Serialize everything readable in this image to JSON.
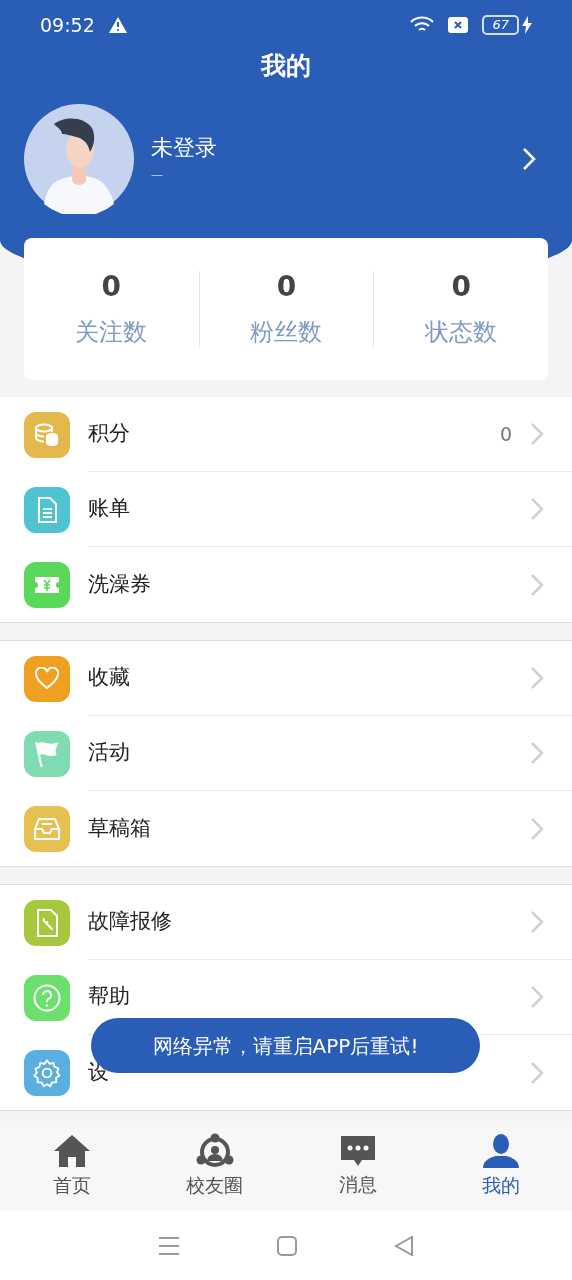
{
  "status_bar": {
    "time": "09:52",
    "battery": "67"
  },
  "header": {
    "title": "我的"
  },
  "profile": {
    "name": "未登录",
    "subtitle": "—"
  },
  "stats": [
    {
      "value": "0",
      "label": "关注数"
    },
    {
      "value": "0",
      "label": "粉丝数"
    },
    {
      "value": "0",
      "label": "状态数"
    }
  ],
  "menu_sections": [
    [
      {
        "kind": "coins",
        "label": "积分",
        "value": "0",
        "color": "#e3b94e"
      },
      {
        "kind": "document",
        "label": "账单",
        "color": "#4fc3d0"
      },
      {
        "kind": "ticket",
        "label": "洗澡券",
        "color": "#5ad85a"
      }
    ],
    [
      {
        "kind": "heart",
        "label": "收藏",
        "color": "#f0a020"
      },
      {
        "kind": "flag",
        "label": "活动",
        "color": "#7fdcb0"
      },
      {
        "kind": "tray",
        "label": "草稿箱",
        "color": "#e6c050"
      }
    ],
    [
      {
        "kind": "repair",
        "label": "故障报修",
        "color": "#a6c83c"
      },
      {
        "kind": "help",
        "label": "帮助",
        "color": "#6ce06c"
      },
      {
        "kind": "gear",
        "label": "设",
        "color": "#5aaee0"
      }
    ]
  ],
  "toast": "网络异常，请重启APP后重试!",
  "tab_bar": [
    {
      "kind": "home",
      "label": "首页",
      "selected": false
    },
    {
      "kind": "circle",
      "label": "校友圈",
      "selected": false
    },
    {
      "kind": "message",
      "label": "消息",
      "selected": false
    },
    {
      "kind": "user",
      "label": "我的",
      "selected": true
    }
  ]
}
